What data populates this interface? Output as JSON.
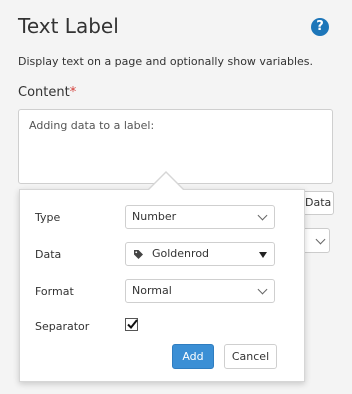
{
  "header": {
    "title": "Text Label",
    "help_icon": "question-circle-icon",
    "description": "Display text on a page and optionally show variables."
  },
  "content": {
    "label": "Content",
    "required_mark": "*",
    "text": "Adding data to a label:"
  },
  "background": {
    "data_button_label": "Data"
  },
  "popover": {
    "fields": {
      "type": {
        "label": "Type",
        "value": "Number"
      },
      "data": {
        "label": "Data",
        "value": "Goldenrod",
        "icon": "tag-icon"
      },
      "format": {
        "label": "Format",
        "value": "Normal"
      },
      "separator": {
        "label": "Separator",
        "checked": true
      }
    },
    "add_label": "Add",
    "cancel_label": "Cancel"
  },
  "colors": {
    "accent": "#3b8fd5",
    "help_icon": "#1d76b9",
    "required": "#d43f3a"
  }
}
